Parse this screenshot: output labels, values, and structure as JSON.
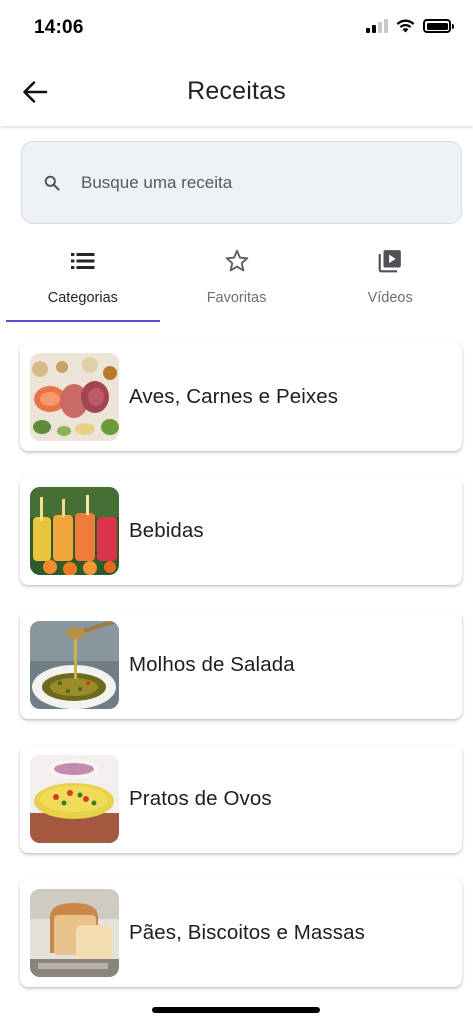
{
  "status_bar": {
    "time": "14:06"
  },
  "app_bar": {
    "title": "Receitas"
  },
  "search": {
    "placeholder": "Busque uma receita",
    "value": ""
  },
  "tabs": [
    {
      "label": "Categorias",
      "icon": "list-icon",
      "active": true
    },
    {
      "label": "Favoritas",
      "icon": "star-outline-icon",
      "active": false
    },
    {
      "label": "Vídeos",
      "icon": "video-library-icon",
      "active": false
    }
  ],
  "categories": [
    {
      "label": "Aves, Carnes e Peixes",
      "thumbnail": "meat-fish-photo"
    },
    {
      "label": "Bebidas",
      "thumbnail": "juices-photo"
    },
    {
      "label": "Molhos de Salada",
      "thumbnail": "salad-dressing-photo"
    },
    {
      "label": "Pratos de Ovos",
      "thumbnail": "omelette-photo"
    },
    {
      "label": "Pães, Biscoitos e Massas",
      "thumbnail": "bread-photo"
    }
  ],
  "colors": {
    "accent": "#5a4bd6",
    "search_background": "#eef1f5",
    "tab_inactive": "#6d6f72"
  }
}
